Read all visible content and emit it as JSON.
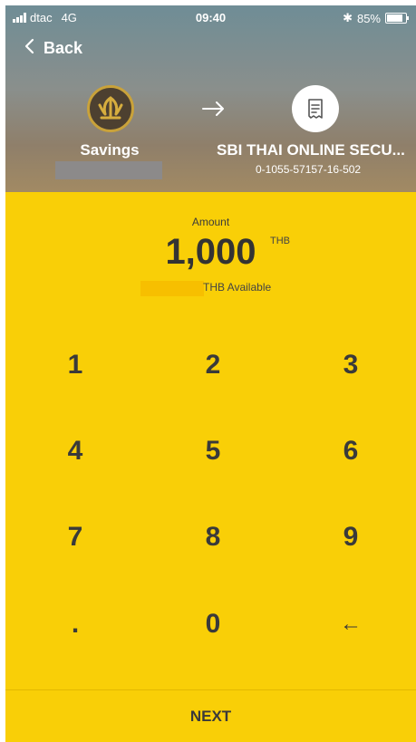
{
  "status_bar": {
    "carrier": "dtac",
    "network": "4G",
    "time": "09:40",
    "battery": "85%",
    "battery_level": 0.85
  },
  "nav": {
    "back_label": "Back"
  },
  "transfer": {
    "from_label": "Savings",
    "to_name": "SBI THAI ONLINE SECU...",
    "to_account": "0-1055-57157-16-502"
  },
  "amount": {
    "label": "Amount",
    "value": "1,000",
    "currency": "THB",
    "available_suffix": "THB Available"
  },
  "keypad": {
    "keys": [
      "1",
      "2",
      "3",
      "4",
      "5",
      "6",
      "7",
      "8",
      "9",
      ".",
      "0",
      "←"
    ]
  },
  "next_label": "NEXT",
  "colors": {
    "accent": "#f9cf07",
    "header_tint": "#8a8f8c",
    "text_dark": "#3a3a3a"
  }
}
